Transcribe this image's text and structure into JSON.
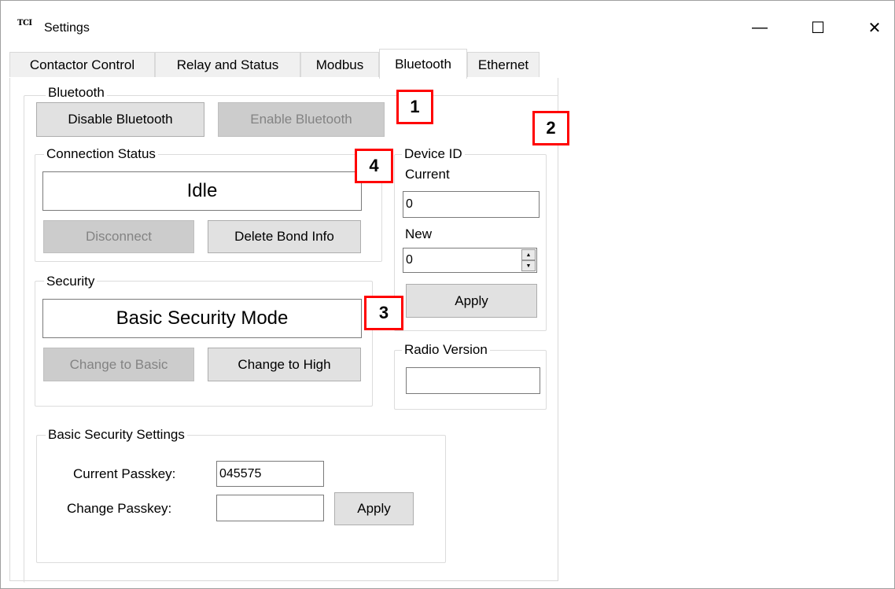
{
  "window": {
    "app_icon_text": "TCI",
    "title": "Settings",
    "minimize_glyph": "—",
    "maximize_glyph": "☐",
    "close_glyph": "✕"
  },
  "tabs": [
    {
      "label": "Contactor Control",
      "active": false
    },
    {
      "label": "Relay and Status",
      "active": false
    },
    {
      "label": "Modbus",
      "active": false
    },
    {
      "label": "Bluetooth",
      "active": true
    },
    {
      "label": "Ethernet",
      "active": false
    }
  ],
  "bluetooth": {
    "group_title": "Bluetooth",
    "disable_label": "Disable Bluetooth",
    "enable_label": "Enable Bluetooth"
  },
  "connection": {
    "group_title": "Connection Status",
    "status": "Idle",
    "disconnect_label": "Disconnect",
    "delete_bond_label": "Delete Bond Info"
  },
  "security": {
    "group_title": "Security",
    "mode": "Basic Security Mode",
    "change_basic_label": "Change to Basic",
    "change_high_label": "Change to High"
  },
  "device_id": {
    "group_title": "Device ID",
    "current_label": "Current",
    "current_value": "0",
    "new_label": "New",
    "new_value": "0",
    "apply_label": "Apply"
  },
  "radio": {
    "group_title": "Radio Version",
    "value": ""
  },
  "basic_security": {
    "group_title": "Basic Security Settings",
    "current_passkey_label": "Current Passkey:",
    "current_passkey_value": "045575",
    "change_passkey_label": "Change Passkey:",
    "change_passkey_value": "",
    "apply_label": "Apply"
  },
  "markers": [
    "1",
    "2",
    "3",
    "4"
  ],
  "colors": {
    "marker_red": "#ff0000",
    "disabled_button": "#cccccc",
    "button": "#e1e1e1"
  }
}
